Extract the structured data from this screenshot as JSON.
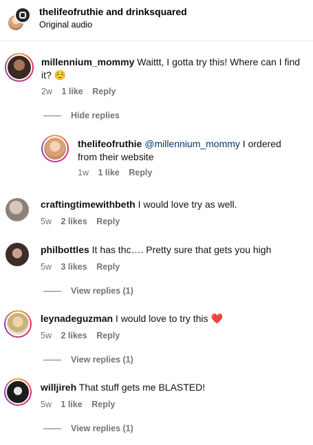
{
  "header": {
    "title": "thelifeofruthie and drinksquared",
    "subtitle": "Original audio"
  },
  "comments": [
    {
      "username": "millennium_mommy",
      "text_line1": "Waittt, I gotta try this! Where can I find",
      "text_line2": "it? ☺️",
      "age": "2w",
      "likes": "1 like",
      "reply": "Reply",
      "toggle": "Hide replies"
    },
    {
      "username": "thelifeofruthie",
      "mention": "@millennium_mommy",
      "text_line1": " I ordered",
      "text_line2": "from their website",
      "age": "1w",
      "likes": "1 like",
      "reply": "Reply"
    },
    {
      "username": "craftingtimewithbeth",
      "text": "I would love try as well.",
      "age": "5w",
      "likes": "2 likes",
      "reply": "Reply"
    },
    {
      "username": "philbottles",
      "text": "It has thc…. Pretty sure that gets you high",
      "age": "5w",
      "likes": "3 likes",
      "reply": "Reply",
      "toggle": "View replies (1)"
    },
    {
      "username": "leynadeguzman",
      "text": "I would love to try this",
      "emoji": "❤️",
      "age": "5w",
      "likes": "2 likes",
      "reply": "Reply",
      "toggle": "View replies (1)"
    },
    {
      "username": "willjireh",
      "text": "That stuff gets me BLASTED!",
      "age": "5w",
      "likes": "1 like",
      "reply": "Reply",
      "toggle": "View replies (1)"
    }
  ]
}
